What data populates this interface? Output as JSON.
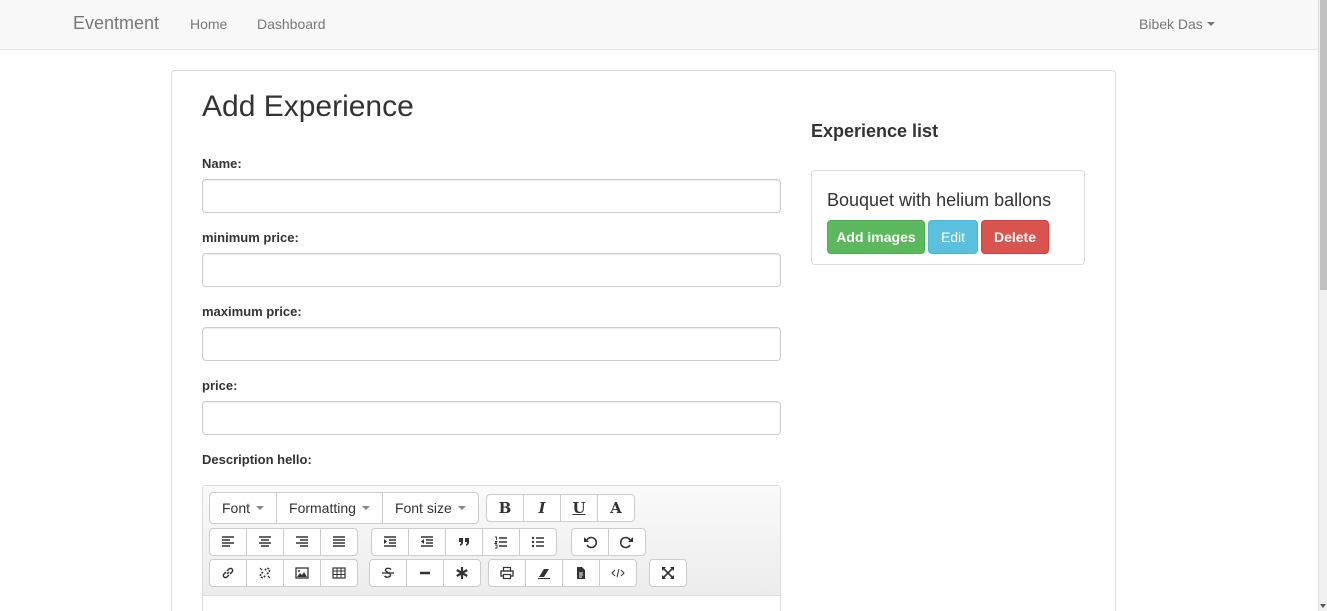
{
  "navbar": {
    "brand": "Eventment",
    "links": [
      "Home",
      "Dashboard"
    ],
    "user": "Bibek Das"
  },
  "form": {
    "title": "Add Experience",
    "fields": [
      {
        "label": "Name:",
        "value": ""
      },
      {
        "label": "minimum price:",
        "value": ""
      },
      {
        "label": "maximum price:",
        "value": ""
      },
      {
        "label": "price:",
        "value": ""
      }
    ],
    "description_label": "Description hello:"
  },
  "editor": {
    "dropdowns": [
      "Font",
      "Formatting",
      "Font size"
    ],
    "style_buttons": [
      "B",
      "I",
      "U",
      "A"
    ],
    "icons_row2": [
      "align-left-icon",
      "align-center-icon",
      "align-right-icon",
      "align-justify-icon",
      "indent-icon",
      "outdent-icon",
      "quote-icon",
      "ordered-list-icon",
      "unordered-list-icon",
      "undo-icon",
      "redo-icon"
    ],
    "icons_row3": [
      "link-icon",
      "unlink-icon",
      "image-icon",
      "table-icon",
      "strikethrough-icon",
      "horizontal-rule-icon",
      "special-char-icon",
      "print-icon",
      "eraser-icon",
      "template-icon",
      "source-code-icon",
      "fullscreen-icon"
    ]
  },
  "experience_list": {
    "title": "Experience list",
    "items": [
      {
        "name": "Bouquet with helium ballons",
        "add_images_label": "Add images",
        "edit_label": "Edit",
        "delete_label": "Delete"
      }
    ]
  },
  "colors": {
    "success": "#5cb85c",
    "info": "#5bc0de",
    "danger": "#d9534f",
    "navbar_bg": "#f8f8f8"
  }
}
